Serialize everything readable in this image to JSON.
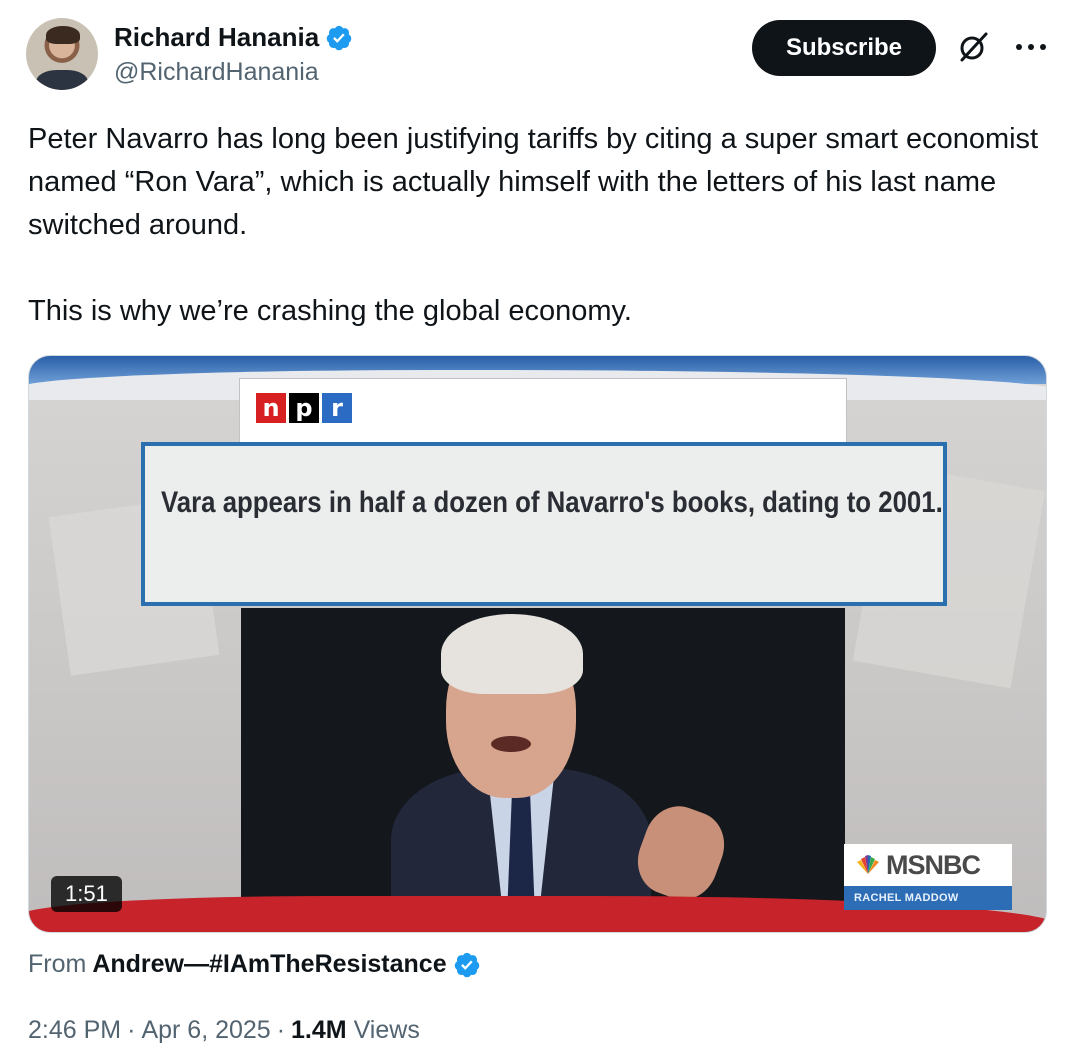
{
  "author": {
    "display_name": "Richard Hanania",
    "handle": "@RichardHanania",
    "verified": true
  },
  "actions": {
    "subscribe_label": "Subscribe",
    "grok_icon": "grok-icon",
    "more_icon": "more-options-icon"
  },
  "tweet": {
    "text": "Peter Navarro has long been justifying tariffs by citing a super smart economist named “Ron Vara”, which is actually himself with the letters of his last name switched around.\n\nThis is why we’re crashing the global economy."
  },
  "media": {
    "npr_letters": [
      "n",
      "p",
      "r"
    ],
    "npr_colors": [
      "#d62021",
      "#000000",
      "#2b6bc4"
    ],
    "quote": "Vara appears in half a dozen of Navarro's books, dating to 2001.",
    "network_name": "MSNBC",
    "show_name": "RACHEL MADDOW",
    "duration": "1:51",
    "accent_red": "#c7232b",
    "accent_blue": "#2b6fae"
  },
  "source": {
    "prefix": "From",
    "name": "Andrew—#IAmTheResistance",
    "verified": true
  },
  "meta": {
    "time": "2:46 PM",
    "separator": "·",
    "date": "Apr 6, 2025",
    "views_count": "1.4M",
    "views_label": "Views"
  }
}
